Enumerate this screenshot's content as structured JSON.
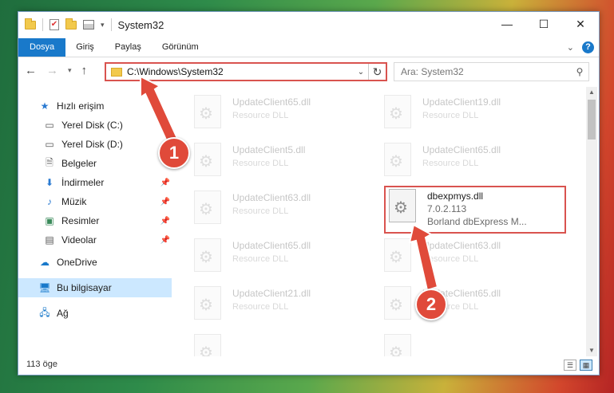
{
  "window": {
    "title": "System32",
    "controls": {
      "minimize": "—",
      "maximize": "☐",
      "close": "✕"
    }
  },
  "ribbon": {
    "tabs": [
      "Dosya",
      "Giriş",
      "Paylaş",
      "Görünüm"
    ]
  },
  "navigation": {
    "address": "C:\\Windows\\System32",
    "search_placeholder": "Ara: System32"
  },
  "sidebar": {
    "items": [
      {
        "label": "Hızlı erişim",
        "icon": "star-icon"
      },
      {
        "label": "Yerel Disk (C:)",
        "icon": "drive-icon",
        "pinned": true
      },
      {
        "label": "Yerel Disk (D:)",
        "icon": "drive-icon"
      },
      {
        "label": "Belgeler",
        "icon": "document-icon"
      },
      {
        "label": "İndirmeler",
        "icon": "download-icon",
        "pinned": true
      },
      {
        "label": "Müzik",
        "icon": "music-icon",
        "pinned": true
      },
      {
        "label": "Resimler",
        "icon": "picture-icon",
        "pinned": true
      },
      {
        "label": "Videolar",
        "icon": "video-icon",
        "pinned": true
      },
      {
        "label": "OneDrive",
        "icon": "cloud-icon"
      },
      {
        "label": "Bu bilgisayar",
        "icon": "computer-icon",
        "selected": true
      },
      {
        "label": "Ağ",
        "icon": "network-icon"
      }
    ]
  },
  "files": [
    {
      "name": "UpdateClient65.dll",
      "desc": "Resource DLL"
    },
    {
      "name": "UpdateClient19.dll",
      "desc": "Resource DLL"
    },
    {
      "name": "UpdateClient5.dll",
      "desc": "Resource DLL"
    },
    {
      "name": "UpdateClient65.dll",
      "desc": "Resource DLL"
    },
    {
      "name": "UpdateClient63.dll",
      "desc": "Resource DLL"
    },
    {
      "name": "UpdateClient65.dll",
      "desc": "Resource DLL"
    },
    {
      "name": "UpdateClient63.dll",
      "desc": "Resource DLL"
    },
    {
      "name": "UpdateClient21.dll",
      "desc": "Resource DLL"
    },
    {
      "name": "UpdateClient65.dll",
      "desc": "Resource DLL"
    }
  ],
  "highlighted_file": {
    "name": "dbexpmys.dll",
    "version": "7.0.2.113",
    "desc": "Borland dbExpress M..."
  },
  "status": {
    "count": "113 öge"
  },
  "annotations": {
    "step1": "1",
    "step2": "2"
  },
  "colors": {
    "accent": "#1979ca",
    "annotation": "#e04a3a",
    "highlight_border": "#d9534f"
  }
}
